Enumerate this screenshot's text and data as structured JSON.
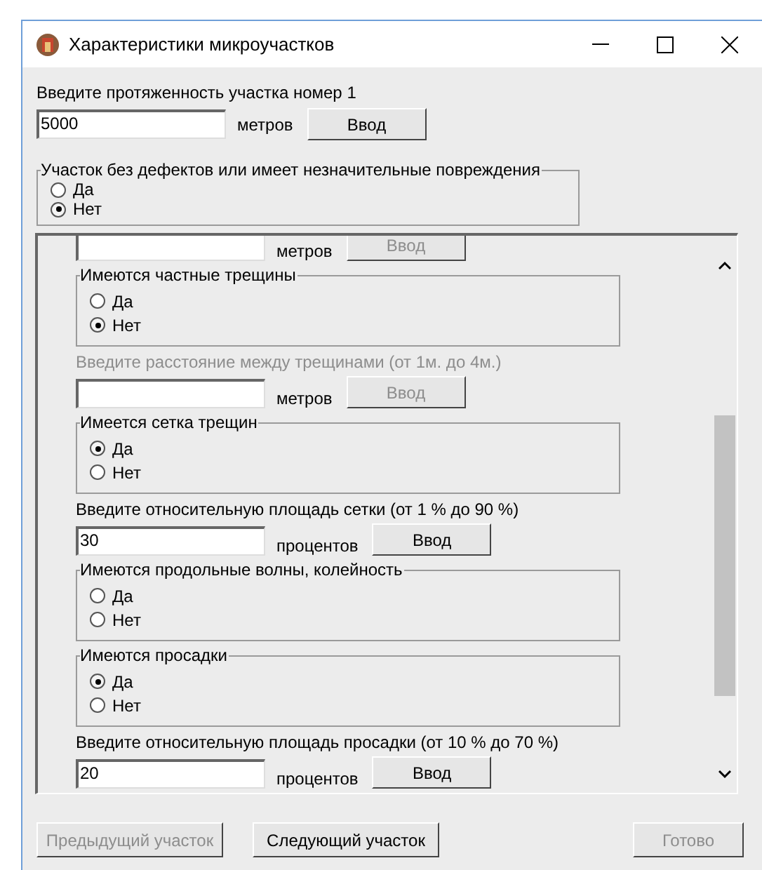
{
  "window": {
    "title": "Характеристики микроучастков"
  },
  "length_prompt": {
    "label": "Введите протяженность участка номер 1",
    "value": "5000",
    "unit": "метров",
    "button": "Ввод"
  },
  "defect_group": {
    "title": "Участок без дефектов или имеет незначительные повреждения",
    "options": [
      {
        "label": "Да",
        "selected": false
      },
      {
        "label": "Нет",
        "selected": true
      }
    ]
  },
  "panel_items": [
    {
      "kind": "input_row",
      "unit": "метров",
      "button": "Ввод",
      "disabled": true
    },
    {
      "kind": "radio_group",
      "title": "Имеются частные трещины",
      "options": [
        {
          "label": "Да",
          "selected": false
        },
        {
          "label": "Нет",
          "selected": true
        }
      ]
    },
    {
      "kind": "input_row",
      "label": "Введите расстояние между трещинами (от 1м. до 4м.)",
      "unit": "метров",
      "button": "Ввод",
      "disabled": true
    },
    {
      "kind": "radio_group",
      "title": "Имеется сетка трещин",
      "options": [
        {
          "label": "Да",
          "selected": true
        },
        {
          "label": "Нет",
          "selected": false
        }
      ]
    },
    {
      "kind": "input_row",
      "label": "Введите относительную площадь сетки (от 1 % до 90 %)",
      "value": "30",
      "unit": "процентов",
      "button": "Ввод",
      "disabled": false
    },
    {
      "kind": "radio_group",
      "title": "Имеются продольные волны, колейность",
      "options": [
        {
          "label": "Да",
          "selected": false
        },
        {
          "label": "Нет",
          "selected": false
        }
      ]
    },
    {
      "kind": "radio_group",
      "title": "Имеются просадки",
      "options": [
        {
          "label": "Да",
          "selected": true
        },
        {
          "label": "Нет",
          "selected": false
        }
      ]
    },
    {
      "kind": "input_row",
      "label": "Введите относительную площадь просадки (от 10 % до 70 %)",
      "value": "20",
      "unit": "процентов",
      "button": "Ввод",
      "disabled": false
    }
  ],
  "footer_buttons": [
    {
      "label": "Предыдущий участок",
      "disabled": true
    },
    {
      "label": "Следующий участок",
      "disabled": false
    },
    {
      "label": "Готово",
      "disabled": true
    }
  ]
}
